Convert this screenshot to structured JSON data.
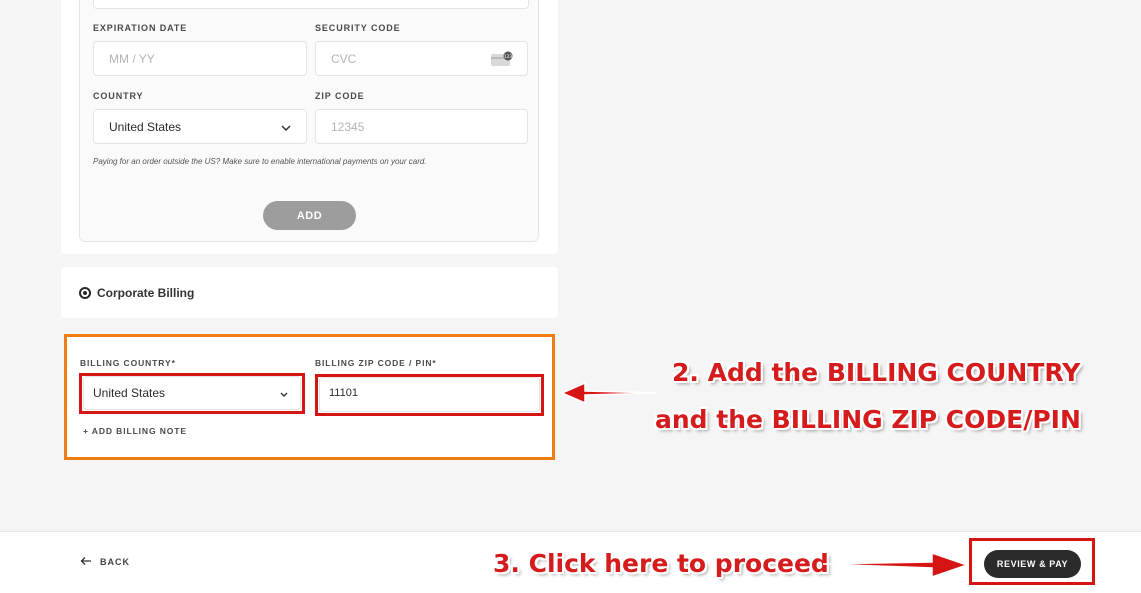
{
  "card_form": {
    "expiration_label": "EXPIRATION DATE",
    "expiration_placeholder": "MM / YY",
    "security_label": "SECURITY CODE",
    "security_placeholder": "CVC",
    "country_label": "COUNTRY",
    "country_value": "United States",
    "zip_label": "ZIP CODE",
    "zip_placeholder": "12345",
    "note": "Paying for an order outside the US? Make sure to enable international payments on your card.",
    "add_label": "ADD"
  },
  "corporate": {
    "label": "Corporate Billing",
    "selected": true
  },
  "billing": {
    "country_label": "BILLING COUNTRY*",
    "country_value": "United States",
    "zip_label": "BILLING ZIP CODE / PIN*",
    "zip_value": "11101",
    "add_note_label": "+ ADD BILLING NOTE"
  },
  "annotations": {
    "step2_line1": "2. Add the BILLING COUNTRY",
    "step2_line2": "and the BILLING ZIP CODE/PIN",
    "step3": "3. Click here to proceed"
  },
  "footer": {
    "back_label": "BACK",
    "pay_label": "REVIEW & PAY"
  },
  "colors": {
    "annotation_red": "#d61414",
    "highlight_orange": "#f07c12",
    "primary_button": "#2b2b2b",
    "disabled_button": "#9d9d9d"
  }
}
